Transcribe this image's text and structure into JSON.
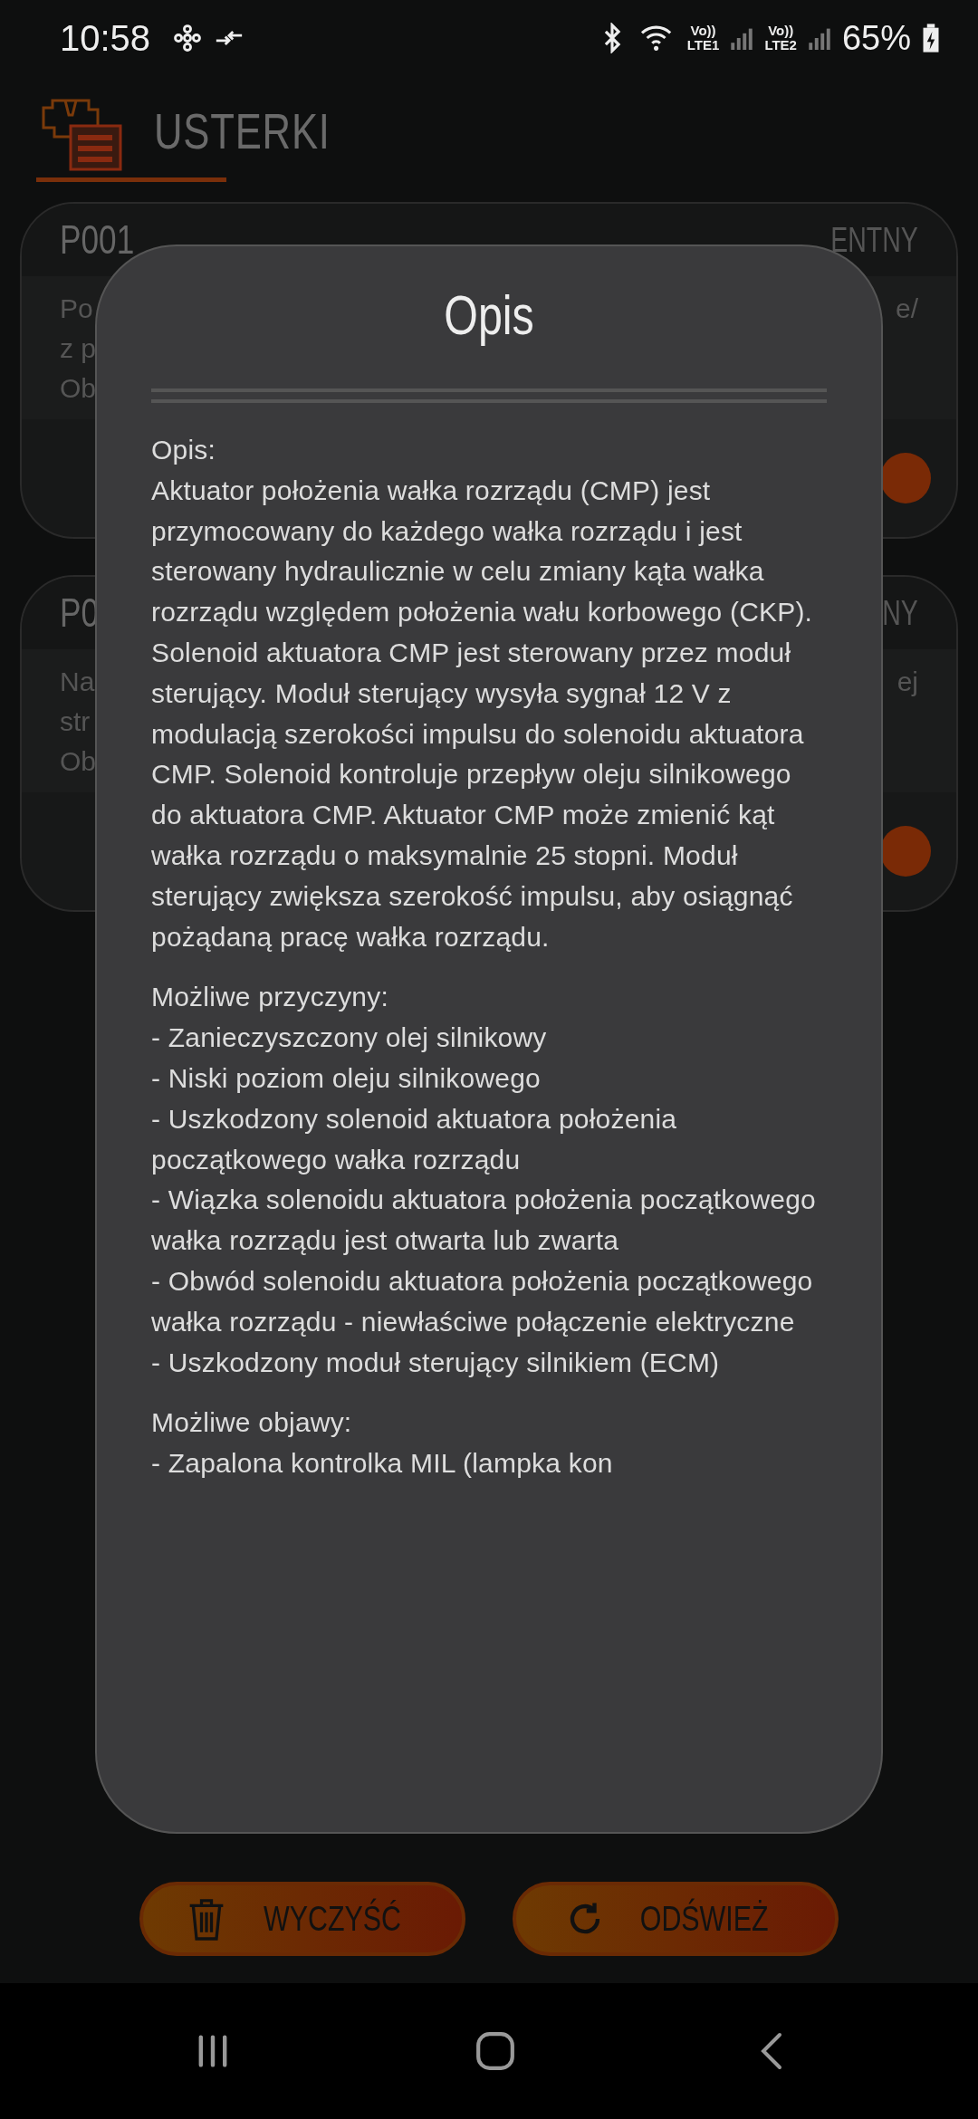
{
  "status_bar": {
    "time": "10:58",
    "network_1": "LTE1",
    "network_2": "LTE2",
    "volte_1": "Vo))",
    "volte_2": "Vo))",
    "battery": "65%"
  },
  "header": {
    "title": "USTERKI"
  },
  "cards": [
    {
      "code": "P001",
      "status": "ENTNY",
      "left_lines": [
        "Po",
        "z p",
        "Ob"
      ],
      "right_lines": [
        "e/"
      ]
    },
    {
      "code": "P0",
      "status": "NY",
      "left_lines": [
        "Na",
        "str",
        "Ob"
      ],
      "right_lines": [
        "ej"
      ]
    }
  ],
  "dialog": {
    "title": "Opis",
    "sections": [
      {
        "heading": "Opis:",
        "lines": [
          "Aktuator położenia wałka rozrządu (CMP) jest przymocowany do każdego wałka rozrządu i jest sterowany hydraulicznie w celu zmiany kąta wałka rozrządu względem położenia wału korbowego (CKP). Solenoid aktuatora CMP jest sterowany przez moduł sterujący. Moduł sterujący wysyła sygnał 12 V z modulacją szerokości impulsu do solenoidu aktuatora CMP. Solenoid kontroluje przepływ oleju silnikowego do aktuatora CMP. Aktuator CMP może zmienić kąt wałka rozrządu o maksymalnie 25 stopni. Moduł sterujący zwiększa szerokość impulsu, aby osiągnąć pożądaną pracę wałka rozrządu."
        ]
      },
      {
        "heading": "Możliwe przyczyny:",
        "lines": [
          "- Zanieczyszczony olej silnikowy",
          "- Niski poziom oleju silnikowego",
          "- Uszkodzony solenoid aktuatora położenia początkowego wałka rozrządu",
          "- Wiązka solenoidu aktuatora położenia początkowego wałka rozrządu jest otwarta lub zwarta",
          "- Obwód solenoidu aktuatora położenia początkowego wałka rozrządu - niewłaściwe połączenie elektryczne",
          "- Uszkodzony moduł sterujący silnikiem (ECM)"
        ]
      },
      {
        "heading": "Możliwe objawy:",
        "lines": [
          "- Zapalona kontrolka MIL (lampka kon"
        ]
      }
    ]
  },
  "buttons": [
    {
      "label": "WYCZYŚĆ",
      "kind": "clear"
    },
    {
      "label": "ODŚWIEŻ",
      "kind": "refresh"
    }
  ]
}
